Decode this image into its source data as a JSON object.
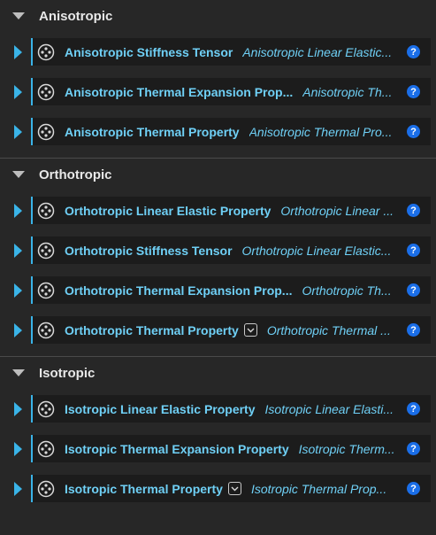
{
  "accent_color": "#3ab4e8",
  "text_color": "#6fd0f6",
  "help_color": "#1a6ee8",
  "sections": [
    {
      "title": "Anisotropic",
      "rows": [
        {
          "name": "Anisotropic Stiffness Tensor",
          "type": "Anisotropic Linear Elastic...",
          "icon": "node-icon",
          "has_dropdown": false
        },
        {
          "name": "Anisotropic Thermal Expansion Prop...",
          "type": "Anisotropic Th...",
          "icon": "node-icon",
          "has_dropdown": false
        },
        {
          "name": "Anisotropic Thermal Property",
          "type": "Anisotropic Thermal Pro...",
          "icon": "node-icon",
          "has_dropdown": false
        }
      ]
    },
    {
      "title": "Orthotropic",
      "rows": [
        {
          "name": "Orthotropic Linear Elastic Property",
          "type": "Orthotropic Linear ...",
          "icon": "node-icon",
          "has_dropdown": false
        },
        {
          "name": "Orthotropic Stiffness Tensor",
          "type": "Orthotropic Linear Elastic...",
          "icon": "node-icon",
          "has_dropdown": false
        },
        {
          "name": "Orthotropic Thermal Expansion Prop...",
          "type": "Orthotropic Th...",
          "icon": "node-icon",
          "has_dropdown": false
        },
        {
          "name": "Orthotropic Thermal Property",
          "type": "Orthotropic Thermal ...",
          "icon": "node-icon",
          "has_dropdown": true
        }
      ]
    },
    {
      "title": "Isotropic",
      "rows": [
        {
          "name": "Isotropic Linear Elastic Property",
          "type": "Isotropic Linear Elasti...",
          "icon": "node-icon",
          "has_dropdown": false
        },
        {
          "name": "Isotropic Thermal Expansion Property",
          "type": "Isotropic Therm...",
          "icon": "node-icon",
          "has_dropdown": false
        },
        {
          "name": "Isotropic Thermal Property",
          "type": "Isotropic Thermal Prop...",
          "icon": "node-icon",
          "has_dropdown": true
        }
      ]
    }
  ],
  "help_label": "?"
}
